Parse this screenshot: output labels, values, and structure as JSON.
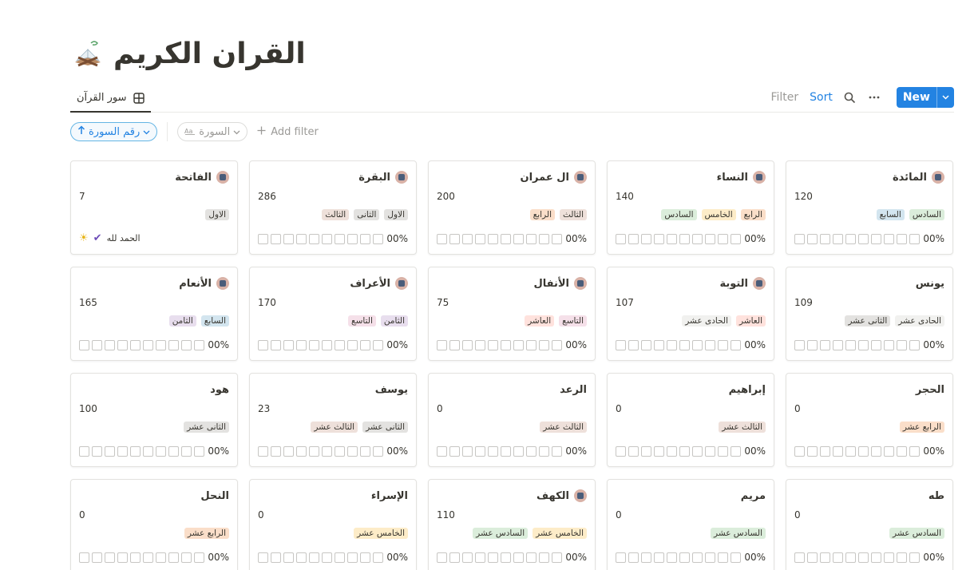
{
  "page": {
    "title": "القران الكريم",
    "icon": "quran-book-icon"
  },
  "view": {
    "tab_label": "سور القرآن",
    "tab_icon": "gallery-grid-icon"
  },
  "toolbar": {
    "filter_label": "Filter",
    "sort_label": "Sort",
    "new_label": "New"
  },
  "filters": {
    "sort_pill": "رقم السورة",
    "property_pill": "السورة",
    "add_filter": "Add filter"
  },
  "colors": {
    "accent": "#2383e2",
    "tag_gray": "#e3e2e0",
    "tag_brown": "#eee0da",
    "tag_orange": "#fadec9",
    "tag_yellow": "#fdecc8",
    "tag_green": "#dbeddb",
    "tag_blue": "#d3e5ef",
    "tag_purple": "#e8deee",
    "tag_pink": "#f5e0e9",
    "tag_red": "#ffe2dd"
  },
  "cards": [
    {
      "name": "الفاتحة",
      "count": "7",
      "icon": true,
      "tags": [
        {
          "label": "الاول",
          "color": "#e3e2e0"
        }
      ],
      "note": {
        "text": "الحمد لله"
      }
    },
    {
      "name": "البقرة",
      "count": "286",
      "icon": true,
      "tags": [
        {
          "label": "الاول",
          "color": "#e3e2e0"
        },
        {
          "label": "الثانى",
          "color": "#e3e2e0"
        },
        {
          "label": "الثالث",
          "color": "#eee0da"
        }
      ],
      "progress": "00%"
    },
    {
      "name": "ال عمران",
      "count": "200",
      "icon": true,
      "tags": [
        {
          "label": "الثالث",
          "color": "#eee0da"
        },
        {
          "label": "الرابع",
          "color": "#fadec9"
        }
      ],
      "progress": "00%"
    },
    {
      "name": "النساء",
      "count": "140",
      "icon": true,
      "tags": [
        {
          "label": "الرابع",
          "color": "#fadec9"
        },
        {
          "label": "الخامس",
          "color": "#fdecc8"
        },
        {
          "label": "السادس",
          "color": "#dbeddb"
        }
      ],
      "progress": "00%"
    },
    {
      "name": "المائدة",
      "count": "120",
      "icon": true,
      "tags": [
        {
          "label": "السادس",
          "color": "#dbeddb"
        },
        {
          "label": "السابع",
          "color": "#d3e5ef"
        }
      ],
      "progress": "00%"
    },
    {
      "name": "الأنعام",
      "count": "165",
      "icon": true,
      "tags": [
        {
          "label": "السابع",
          "color": "#d3e5ef"
        },
        {
          "label": "الثامن",
          "color": "#e8deee"
        }
      ],
      "progress": "00%"
    },
    {
      "name": "الأعراف",
      "count": "170",
      "icon": true,
      "tags": [
        {
          "label": "الثامن",
          "color": "#e8deee"
        },
        {
          "label": "التاسع",
          "color": "#f5e0e9"
        }
      ],
      "progress": "00%"
    },
    {
      "name": "الأنفال",
      "count": "75",
      "icon": true,
      "tags": [
        {
          "label": "التاسع",
          "color": "#f5e0e9"
        },
        {
          "label": "العاشر",
          "color": "#ffe2dd"
        }
      ],
      "progress": "00%"
    },
    {
      "name": "التوبة",
      "count": "107",
      "icon": true,
      "tags": [
        {
          "label": "العاشر",
          "color": "#ffe2dd"
        },
        {
          "label": "الحادى عشر",
          "color": "#f1f1ef"
        }
      ],
      "progress": "00%"
    },
    {
      "name": "يونس",
      "count": "109",
      "icon": false,
      "tags": [
        {
          "label": "الحادى عشر",
          "color": "#f1f1ef"
        },
        {
          "label": "الثانى عشر",
          "color": "#e3e2e0"
        }
      ],
      "progress": "00%"
    },
    {
      "name": "هود",
      "count": "100",
      "icon": false,
      "tags": [
        {
          "label": "الثانى عشر",
          "color": "#e3e2e0"
        }
      ],
      "progress": "00%"
    },
    {
      "name": "يوسف",
      "count": "23",
      "icon": false,
      "tags": [
        {
          "label": "الثانى عشر",
          "color": "#e3e2e0"
        },
        {
          "label": "الثالث عشر",
          "color": "#eee0da"
        }
      ],
      "progress": "00%"
    },
    {
      "name": "الرعد",
      "count": "0",
      "icon": false,
      "tags": [
        {
          "label": "الثالث عشر",
          "color": "#eee0da"
        }
      ],
      "progress": "00%"
    },
    {
      "name": "إبراهيم",
      "count": "0",
      "icon": false,
      "tags": [
        {
          "label": "الثالث عشر",
          "color": "#eee0da"
        }
      ],
      "progress": "00%"
    },
    {
      "name": "الحجر",
      "count": "0",
      "icon": false,
      "tags": [
        {
          "label": "الرابع عشر",
          "color": "#fadec9"
        }
      ],
      "progress": "00%"
    },
    {
      "name": "النحل",
      "count": "0",
      "icon": false,
      "tags": [
        {
          "label": "الرابع عشر",
          "color": "#fadec9"
        }
      ],
      "progress": "00%"
    },
    {
      "name": "الإسراء",
      "count": "0",
      "icon": false,
      "tags": [
        {
          "label": "الخامس عشر",
          "color": "#fdecc8"
        }
      ],
      "progress": "00%"
    },
    {
      "name": "الكهف",
      "count": "110",
      "icon": true,
      "tags": [
        {
          "label": "الخامس عشر",
          "color": "#fdecc8"
        },
        {
          "label": "السادس عشر",
          "color": "#dbeddb"
        }
      ],
      "progress": "00%"
    },
    {
      "name": "مريم",
      "count": "0",
      "icon": false,
      "tags": [
        {
          "label": "السادس عشر",
          "color": "#dbeddb"
        }
      ],
      "progress": "00%"
    },
    {
      "name": "طه",
      "count": "0",
      "icon": false,
      "tags": [
        {
          "label": "السادس عشر",
          "color": "#dbeddb"
        }
      ],
      "progress": "00%"
    }
  ]
}
